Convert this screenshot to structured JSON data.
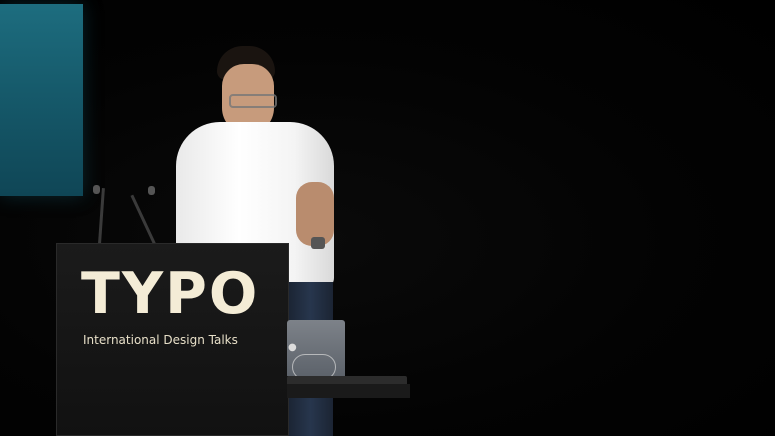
{
  "podium": {
    "logo": "TYPO",
    "subtitle": "International Design Talks"
  },
  "icons": {
    "laptop_logo": "apple-icon"
  },
  "colors": {
    "screen": "#1d6d7f",
    "logo_text": "#f4ecd6",
    "background": "#000000"
  }
}
